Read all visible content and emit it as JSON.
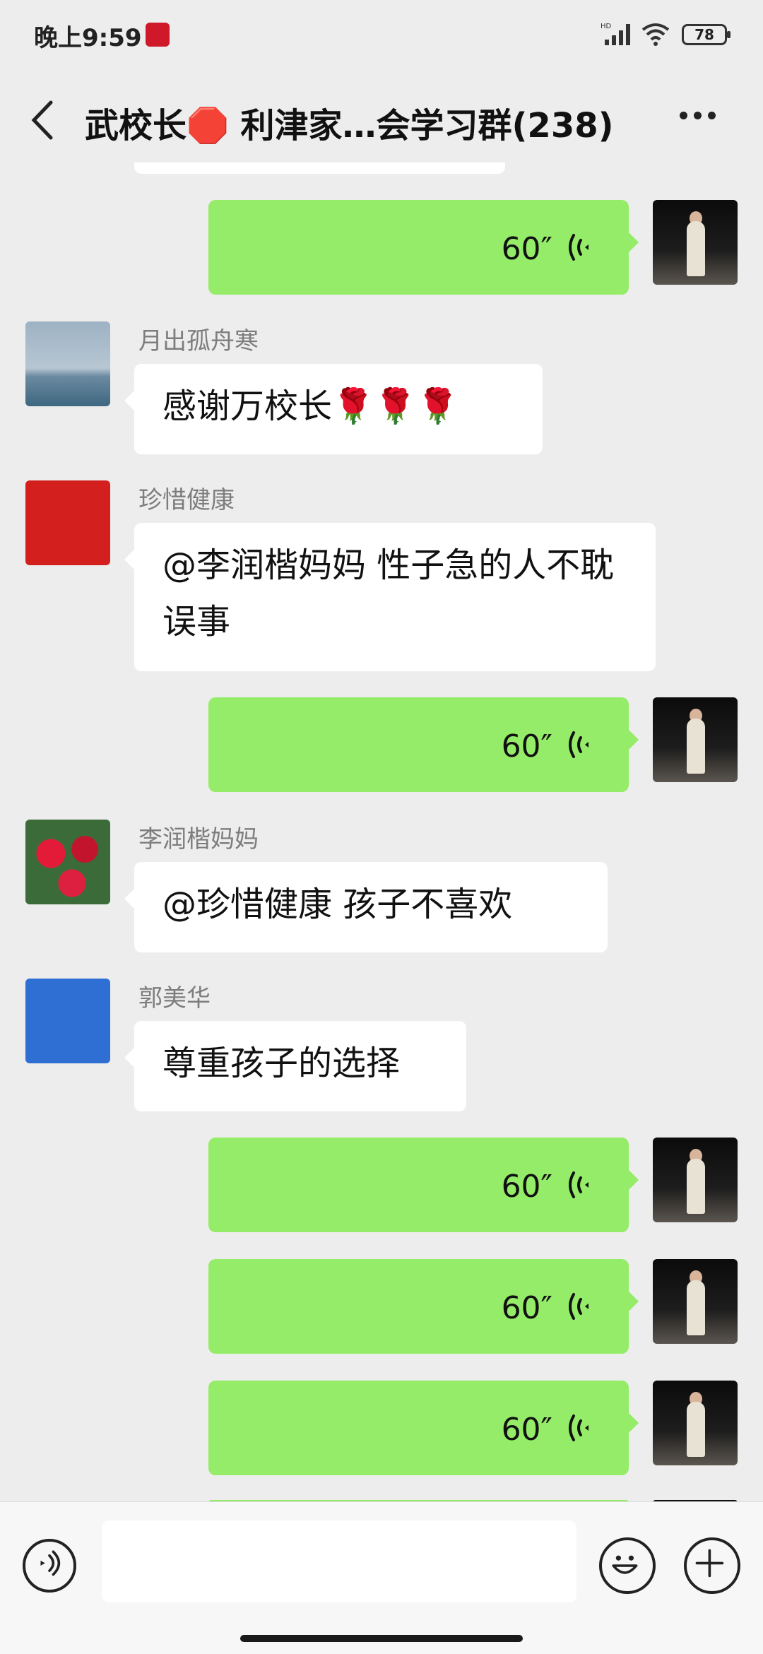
{
  "status_bar": {
    "time": "晚上9:59",
    "battery": "78",
    "network": "HD"
  },
  "header": {
    "title": "武校长🛑 利津家…会学习群(238)"
  },
  "messages": [
    {
      "type": "voice",
      "self": true,
      "duration": "60″"
    },
    {
      "type": "text",
      "self": false,
      "sender": "月出孤舟寒",
      "text": "感谢万校长🌹🌹🌹"
    },
    {
      "type": "text",
      "self": false,
      "sender": "珍惜健康",
      "text": "@李润楷妈妈  性子急的人不耽误事"
    },
    {
      "type": "voice",
      "self": true,
      "duration": "60″"
    },
    {
      "type": "text",
      "self": false,
      "sender": "李润楷妈妈",
      "text": "@珍惜健康  孩子不喜欢"
    },
    {
      "type": "text",
      "self": false,
      "sender": "郭美华",
      "text": "尊重孩子的选择"
    },
    {
      "type": "voice",
      "self": true,
      "duration": "60″"
    },
    {
      "type": "voice",
      "self": true,
      "duration": "60″"
    },
    {
      "type": "voice",
      "self": true,
      "duration": "60″"
    }
  ],
  "colors": {
    "voice_bubble": "#95ec69",
    "chat_bg": "#ededed"
  }
}
